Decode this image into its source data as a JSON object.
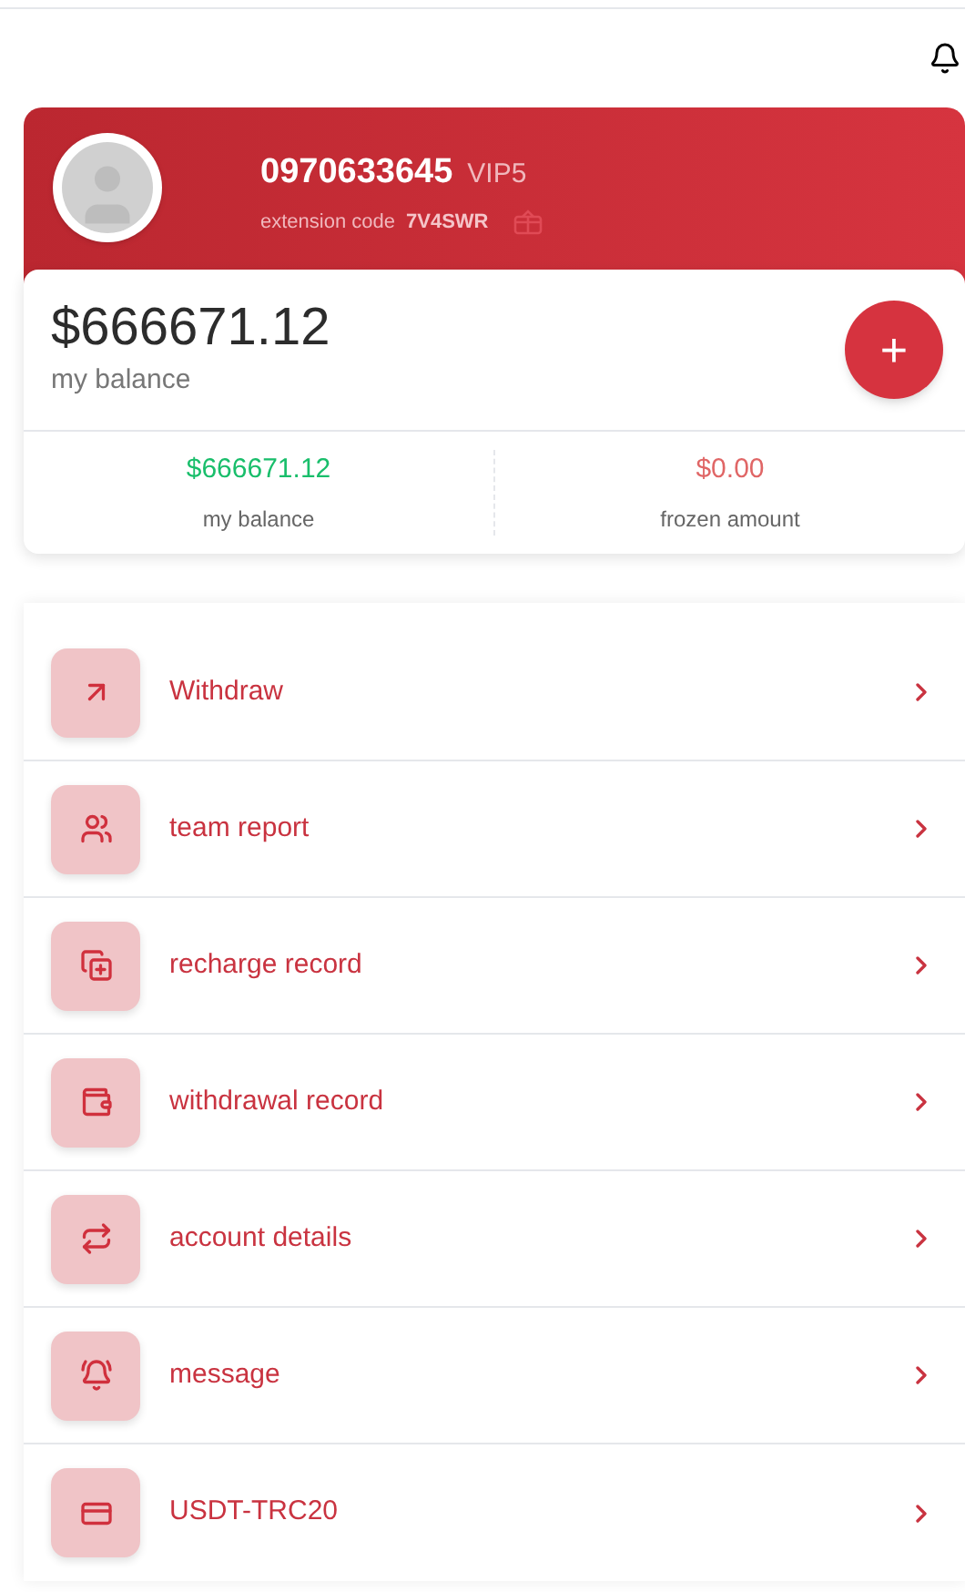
{
  "profile": {
    "phone": "0970633645",
    "vip": "VIP5",
    "code_label": "extension code",
    "code": "7V4SWR"
  },
  "balance": {
    "amount": "$666671.12",
    "label": "my balance",
    "add": "+"
  },
  "stats": [
    {
      "value": "$666671.12",
      "label": "my balance",
      "color": "#19be6b"
    },
    {
      "value": "$0.00",
      "label": "frozen amount",
      "color": "#e06666"
    }
  ],
  "menu": [
    {
      "label": "Withdraw"
    },
    {
      "label": "team report"
    },
    {
      "label": "recharge record"
    },
    {
      "label": "withdrawal record"
    },
    {
      "label": "account details"
    },
    {
      "label": "message"
    },
    {
      "label": "USDT-TRC20"
    }
  ]
}
